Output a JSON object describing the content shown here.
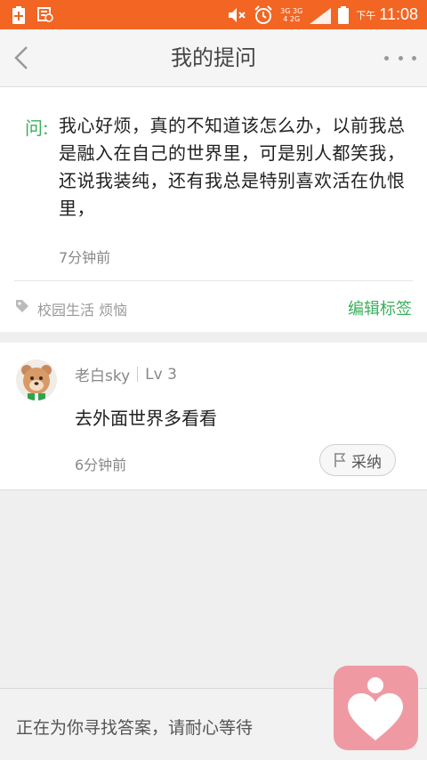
{
  "status_bar": {
    "network_top": "3G 3G",
    "network_bottom": "4 2G",
    "ampm": "下午",
    "time": "11:08"
  },
  "header": {
    "title": "我的提问"
  },
  "question": {
    "prefix": "问:",
    "text": "我心好烦，真的不知道该怎么办，以前我总是融入在自己的世界里，可是别人都笑我，还说我装纯，还有我总是特别喜欢活在仇恨里，",
    "time": "7分钟前",
    "tags": "校园生活 烦恼",
    "edit_tags_label": "编辑标签"
  },
  "answer": {
    "username": "老白sky",
    "level": "Lv 3",
    "text": "去外面世界多看看",
    "time": "6分钟前",
    "adopt_label": "采纳"
  },
  "bottom": {
    "waiting_text": "正在为你寻找答案，请耐心等待"
  },
  "colors": {
    "status_bar": "#f26522",
    "accent_green": "#3dae5c",
    "fab": "#ef9aa2"
  }
}
